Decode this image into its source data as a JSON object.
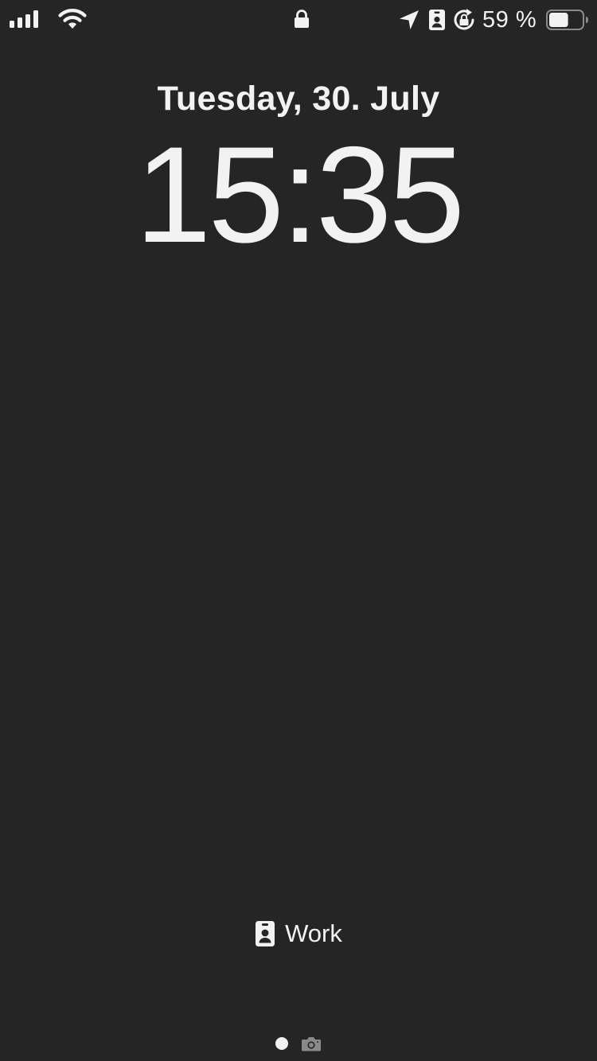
{
  "status_bar": {
    "signal_icon": "cellular-signal-icon",
    "wifi_icon": "wifi-icon",
    "lock_icon": "lock-icon",
    "location_icon": "location-arrow-icon",
    "focus_icon": "id-badge-icon",
    "orientation_icon": "orientation-lock-icon",
    "battery_percent": "59 %",
    "battery_level": 0.59,
    "battery_icon": "battery-icon"
  },
  "lock_screen": {
    "date": "Tuesday, 30. July",
    "time": "15:35"
  },
  "focus_mode": {
    "icon": "id-badge-icon",
    "label": "Work"
  },
  "page_indicator": {
    "pages": [
      "dot",
      "camera"
    ],
    "active_index": 0
  },
  "colors": {
    "background": "#252525",
    "foreground": "#f2f2f2",
    "muted": "#8a8a8a"
  }
}
